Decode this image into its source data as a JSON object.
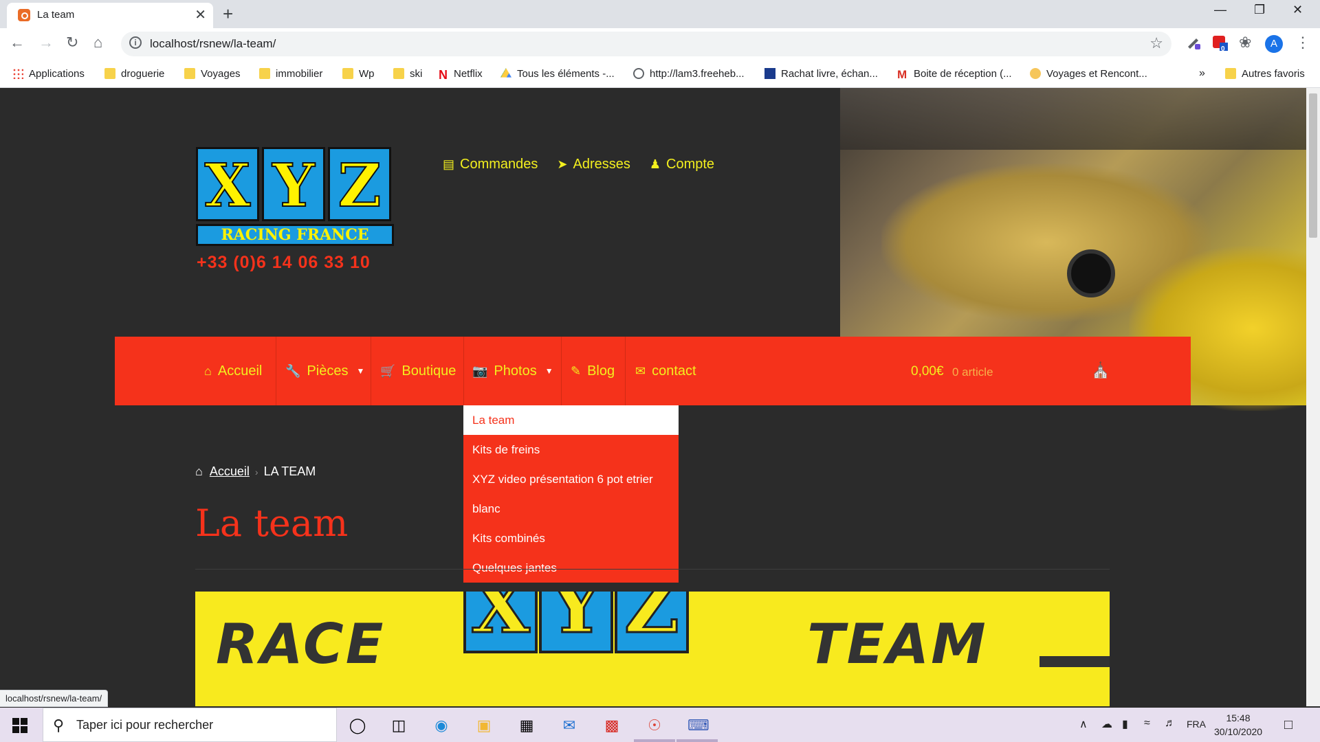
{
  "browser": {
    "tab_title": "La team",
    "tab_close": "✕",
    "new_tab": "+",
    "url": "localhost/rsnew/la-team/",
    "status_url": "localhost/rsnew/la-team/",
    "avatar_letter": "A",
    "extension_badge": "0",
    "bookmarks": [
      {
        "label": "Applications",
        "icon": "apps-grid-icon"
      },
      {
        "label": "droguerie",
        "icon": "folder-icon"
      },
      {
        "label": "Voyages",
        "icon": "folder-icon"
      },
      {
        "label": "immobilier",
        "icon": "folder-icon"
      },
      {
        "label": "Wp",
        "icon": "folder-icon"
      },
      {
        "label": "ski",
        "icon": "folder-icon"
      },
      {
        "label": "Netflix",
        "icon": "netflix-icon"
      },
      {
        "label": "Tous les éléments -...",
        "icon": "drive-icon"
      },
      {
        "label": "http://lam3.freeheb...",
        "icon": "globe-icon"
      },
      {
        "label": "Rachat livre, échan...",
        "icon": "site-icon"
      },
      {
        "label": "Boite de réception (...",
        "icon": "gmail-icon"
      },
      {
        "label": "Voyages et Ren­cont...",
        "icon": "site-icon"
      }
    ],
    "bookmarks_more": "»",
    "other_bookmarks": "Autres favoris"
  },
  "site": {
    "logo_letters": [
      "X",
      "Y",
      "Z"
    ],
    "logo_subtitle": "RACING FRANCE",
    "phone": "+33 (0)6 14 06 33 10",
    "top_nav": [
      {
        "label": "Commandes",
        "icon": "document-icon"
      },
      {
        "label": "Adresses",
        "icon": "send-icon"
      },
      {
        "label": "Compte",
        "icon": "user-icon"
      }
    ],
    "main_nav": [
      {
        "label": "Accueil",
        "icon": "home-icon"
      },
      {
        "label": "Pièces",
        "icon": "wrench-icon"
      },
      {
        "label": "Boutique",
        "icon": "cart-icon"
      },
      {
        "label": "Photos",
        "icon": "camera-icon"
      },
      {
        "label": "Blog",
        "icon": "edit-icon"
      },
      {
        "label": "contact",
        "icon": "mail-icon"
      }
    ],
    "cart_total": "0,00€",
    "cart_count": "0 article",
    "photos_dropdown": [
      "La team",
      "Kits de freins",
      "XYZ video présentation 6 pot etrier",
      "blanc",
      "Kits combinés",
      "Quelques jantes"
    ],
    "breadcrumb_home": "Accueil",
    "breadcrumb_current": "LA TEAM",
    "page_title": "La team",
    "banner_left": "RACE",
    "banner_right": "TEAM",
    "banner_letters": [
      "X",
      "Y",
      "Z"
    ]
  },
  "taskbar": {
    "search_placeholder": "Taper ici pour rechercher",
    "language": "FRA",
    "time": "15:48",
    "date": "30/10/2020"
  },
  "colors": {
    "accent_red": "#f5321b",
    "nav_yellow": "#f3ef1e",
    "page_bg": "#2b2b2b"
  }
}
